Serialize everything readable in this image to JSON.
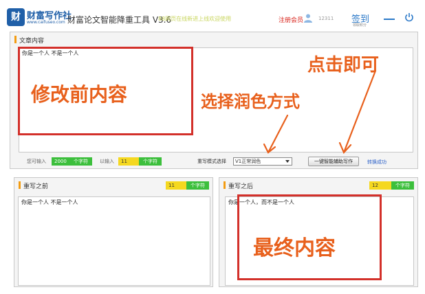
{
  "header": {
    "logo_mark": "财",
    "logo_name": "财富写作社",
    "logo_url": "www.caifuseo.com",
    "app_title": "财富论文智能降重工具 V3.6",
    "notice": "88网页在线新进上线欢迎使用",
    "register": "注册会员",
    "user_id": "12311",
    "signin": "签到",
    "signin_sub": "领取积分",
    "icons": [
      "user-icon",
      "minimize-icon",
      "power-icon"
    ]
  },
  "article": {
    "title": "文章内容",
    "content": "你是一个人  不是一个人",
    "can_input_label": "您可输入",
    "can_input_value": "2000",
    "can_input_unit": "个字符",
    "entered_label": "以输入",
    "entered_value": "11",
    "entered_unit": "个字符",
    "mode_label": "重写模式选择",
    "mode_value": "V1正常润色",
    "assist_button": "一键智能辅助写作",
    "success": "转换成功"
  },
  "before": {
    "title": "重写之前",
    "count": "11",
    "unit": "个字符",
    "content": "你是一个人  不是一个人"
  },
  "after": {
    "title": "重写之后",
    "count": "12",
    "unit": "个字符",
    "content": "你是一个人，而不是一个人"
  },
  "annotations": {
    "before_edit": "修改前内容",
    "choose_style": "选择润色方式",
    "click": "点击即可",
    "final": "最终内容"
  },
  "colors": {
    "accent_blue": "#2a78c8",
    "annotation_red": "#d3302a",
    "annotation_orange": "#e8601c",
    "counter_green": "#3cbf3c",
    "counter_yellow": "#f5d820"
  }
}
